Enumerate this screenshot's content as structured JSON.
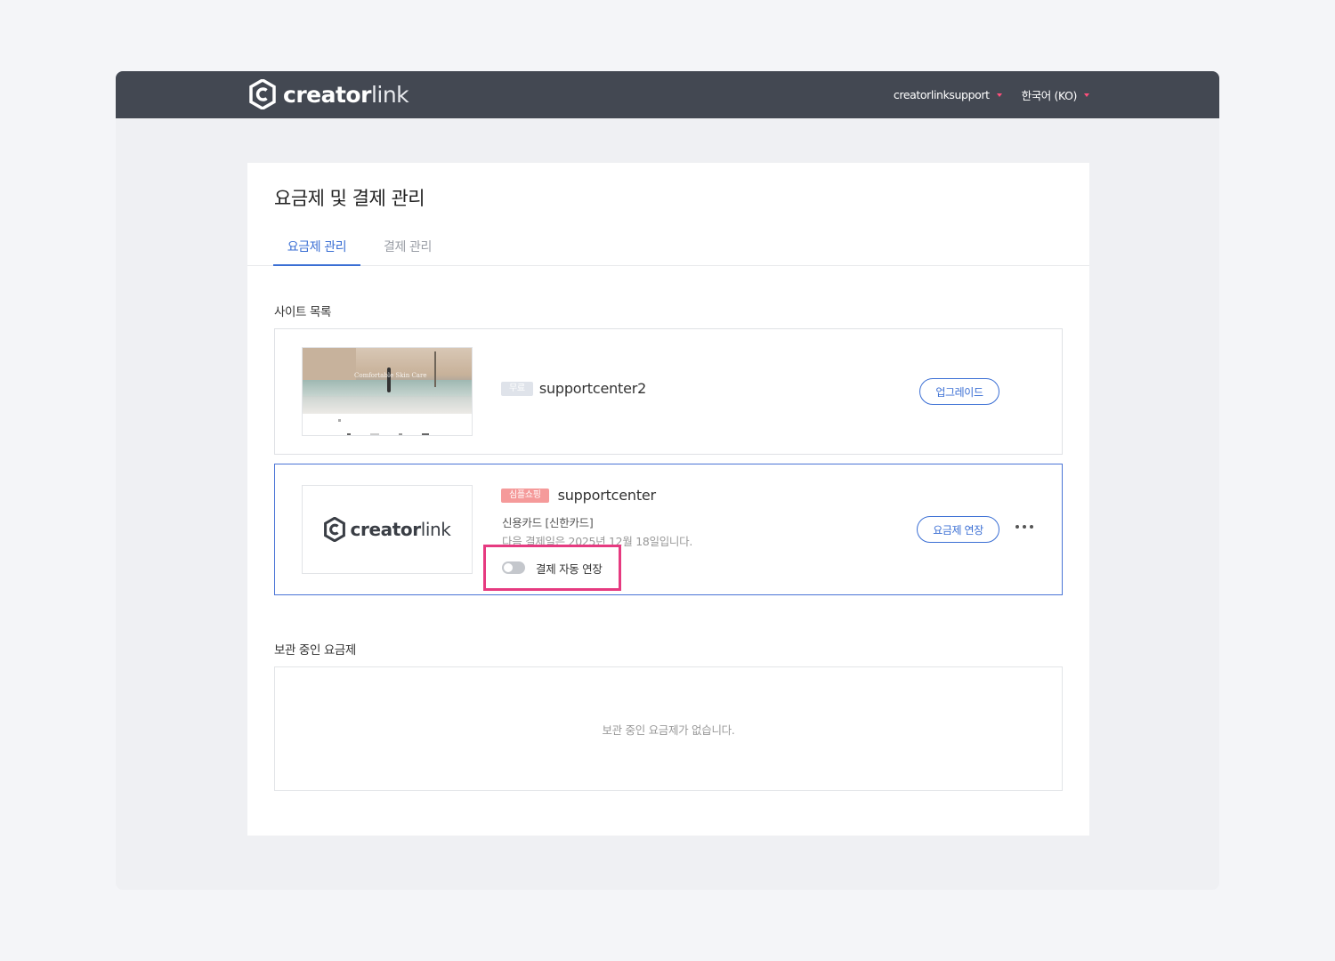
{
  "header": {
    "logo_bold": "creator",
    "logo_light": "link",
    "account_label": "creatorlinksupport",
    "language_label": "한국어 (KO)"
  },
  "page": {
    "title": "요금제 및 결제 관리",
    "tabs": [
      {
        "label": "요금제 관리",
        "active": true
      },
      {
        "label": "결제 관리",
        "active": false
      }
    ]
  },
  "sites_section": {
    "label": "사이트 목록",
    "sites": [
      {
        "badge": "무료",
        "name": "supportcenter2",
        "thumbnail_caption": "Comfortable Skin Care",
        "action_label": "업그레이드"
      },
      {
        "badge": "심플쇼핑",
        "name": "supportcenter",
        "thumbnail_logo_bold": "creator",
        "thumbnail_logo_light": "link",
        "payment_method": "신용카드 [신한카드]",
        "next_payment": "다음 결제일은 2025년 12월 18일입니다.",
        "auto_renew_label": "결제 자동 연장",
        "auto_renew_enabled": false,
        "action_label": "요금제 연장",
        "more_icon": "ellipsis-icon"
      }
    ]
  },
  "archived_section": {
    "label": "보관 중인 요금제",
    "empty_message": "보관 중인 요금제가 없습니다."
  },
  "colors": {
    "header_bg": "#434852",
    "accent": "#3b6fd4",
    "highlight_border": "#e63a80",
    "badge_simple": "#f59a9a",
    "badge_free": "#dfe3ea"
  }
}
